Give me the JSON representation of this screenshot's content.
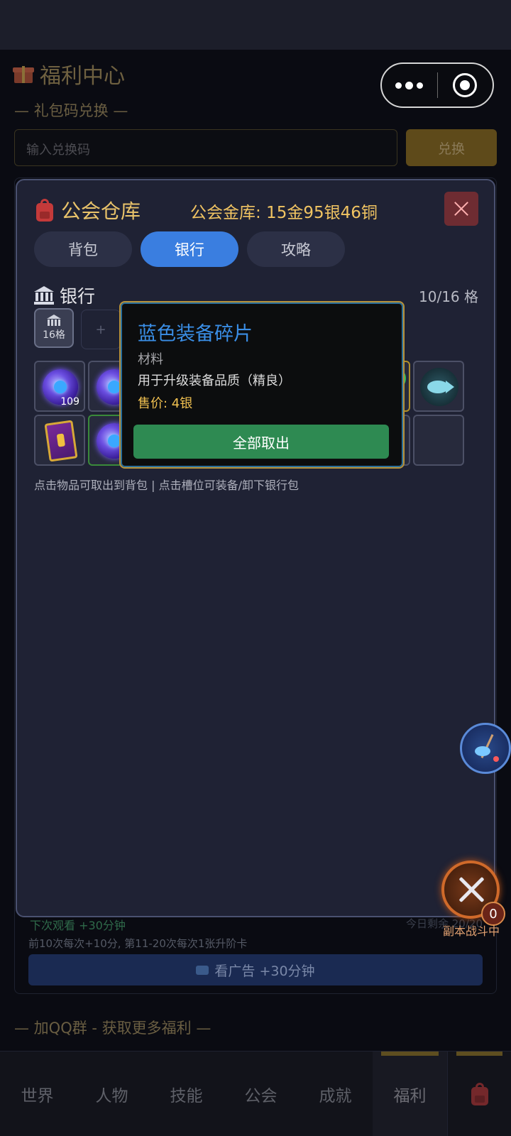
{
  "background": {
    "title": "福利中心",
    "redeem_section": "— 礼包码兑换 —",
    "redeem_placeholder": "输入兑换码",
    "redeem_button": "兑换",
    "ad_next": "下次观看 +30分钟",
    "ad_remaining": "今日剩余 20/20",
    "ad_note": "前10次每次+10分, 第11-20次每次1张升阶卡",
    "ad_button": "看广告 +30分钟",
    "qq_group": "— 加QQ群 - 获取更多福利 —"
  },
  "modal": {
    "title": "公会仓库",
    "gold_label": "公会金库: 15金95银46铜",
    "tabs": [
      {
        "label": "背包",
        "active": false
      },
      {
        "label": "银行",
        "active": true
      },
      {
        "label": "攻略",
        "active": false
      }
    ],
    "section_title": "银行",
    "slot_count": "10/16 格",
    "bag_slot_label": "16格",
    "add_slot_label": "+",
    "items": [
      {
        "icon": "purple-orb-icon",
        "qty": "109",
        "quality": "common"
      },
      {
        "icon": "purple-orb-icon",
        "qty": "",
        "quality": "common"
      },
      {
        "icon": "green-gem-icon",
        "qty": "",
        "quality": "rare"
      },
      {
        "icon": "fish-icon",
        "qty": "",
        "quality": "common"
      },
      {
        "icon": "magic-card-icon",
        "qty": "",
        "quality": "common"
      },
      {
        "icon": "purple-orb-icon",
        "qty": "",
        "quality": "uncommon"
      }
    ],
    "hint": "点击物品可取出到背包 | 点击槽位可装备/卸下银行包"
  },
  "tooltip": {
    "name": "蓝色装备碎片",
    "type": "材料",
    "description": "用于升级装备品质（精良）",
    "price": "售价: 4银",
    "button": "全部取出"
  },
  "floating": {
    "battle_count": "0",
    "battle_label": "副本战斗中"
  },
  "bottom_nav": {
    "items": [
      "世界",
      "人物",
      "技能",
      "公会",
      "成就",
      "福利"
    ],
    "active": "福利"
  },
  "colors": {
    "accent_gold": "#f1c462",
    "tab_active": "#3a7ee0",
    "take_all_button": "#2e8a52",
    "item_name_blue": "#3a8ee6"
  }
}
